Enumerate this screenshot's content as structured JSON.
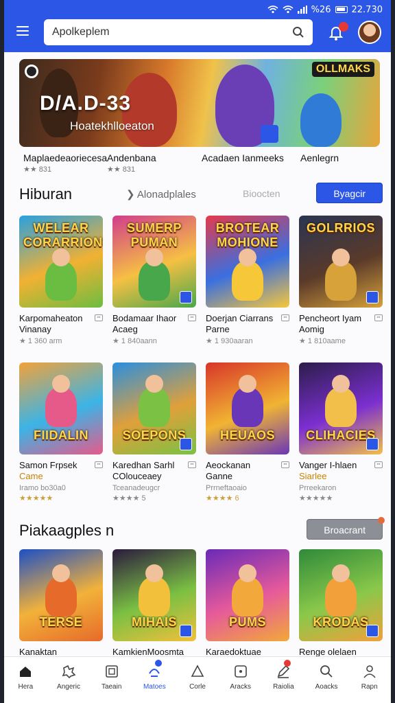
{
  "status": {
    "time": "22.730",
    "battery": "%26"
  },
  "search": {
    "query": "Apolkeplem"
  },
  "banner": {
    "title": "D/A.D-33",
    "subtitle": "Hoatekhlloeaton",
    "logo": "OLLMAKS",
    "captions": [
      {
        "title": "Maplaedeaoriecesa",
        "stars": "★★ 831"
      },
      {
        "title": "Andenbana",
        "stars": "★★ 831"
      },
      {
        "title": "Acadaen Ianmeeks",
        "stars": ""
      },
      {
        "title": "Aenlegrn",
        "stars": ""
      }
    ]
  },
  "section1": {
    "title": "Hiburan",
    "link": "Alonadplales",
    "ghost": "Bioocten",
    "button": "Byagcir"
  },
  "row1": [
    {
      "art": "WELEAR CORARRIONS",
      "name": "Karpomaheaton Vinanay",
      "sub": "",
      "meta": "★ 1 360 arm",
      "stars": "",
      "colors": [
        "#29a0e0",
        "#f2b132",
        "#6bbd41"
      ]
    },
    {
      "art": "SUMERP PUMAN",
      "name": "Bodamaar Ihaor",
      "sub": "Acaeg",
      "meta": "★ 1 840aann",
      "stars": "",
      "colors": [
        "#d13d8c",
        "#f6c043",
        "#48a74b"
      ]
    },
    {
      "art": "BROTEAR MOHIONE",
      "name": "Doerjan Ciarrans Parne",
      "sub": "",
      "meta": "★ 1 930aaran",
      "stars": "",
      "colors": [
        "#e43a4b",
        "#3a6fe0",
        "#f7c73a"
      ]
    },
    {
      "art": "GOLRRIOS",
      "name": "Pencheort Iyam",
      "sub": "Aomig",
      "meta": "★ 1 810aame",
      "stars": "",
      "colors": [
        "#2a3552",
        "#5a3a2a",
        "#d7a23a"
      ]
    }
  ],
  "row2": [
    {
      "art": "FIIDALIN",
      "name": "Samon Frpsek",
      "sub": "Came",
      "meta": "Iramo bo30a0",
      "stars": "★★★★★",
      "gold": true,
      "orange": true,
      "colors": [
        "#f2a23a",
        "#3bb4e6",
        "#e65a8a"
      ]
    },
    {
      "art": "SOEPONS",
      "name": "Karedhan Sarhl COlouceaey",
      "sub": "",
      "meta": "Tceanadeugcr",
      "stars": "★★★★ 5",
      "gold": false,
      "orange": false,
      "colors": [
        "#2a8fe0",
        "#e0a03a",
        "#7bc144"
      ]
    },
    {
      "art": "HEUAOS",
      "name": "Aeockanan Ganne",
      "sub": "",
      "meta": "Prrneftaoaio",
      "stars": "★★★★ 6",
      "gold": true,
      "orange": false,
      "colors": [
        "#d8352a",
        "#f1b433",
        "#6a36b8"
      ]
    },
    {
      "art": "CLIHACIES",
      "name": "Vanger I-hlaen",
      "sub": "Siarlee",
      "meta": "Prreekaron",
      "stars": "★★★★★",
      "gold": false,
      "orange": true,
      "colors": [
        "#2b1d4a",
        "#7b2fd0",
        "#f2c04a"
      ]
    }
  ],
  "section2": {
    "title": "Piakaagples n",
    "button": "Broacrant"
  },
  "row3": [
    {
      "art": "TERSE",
      "name": "Kanaktan Ihuikaak",
      "colors": [
        "#1d4fc6",
        "#f2b23a",
        "#e66a2a"
      ]
    },
    {
      "art": "MIHAIS",
      "name": "KamkienMoosmta",
      "colors": [
        "#2b1a3e",
        "#7ac043",
        "#f2c03a"
      ]
    },
    {
      "art": "PUMS",
      "name": "Karaedoktuae",
      "colors": [
        "#6a2ab8",
        "#e65a9a",
        "#f2a83a"
      ]
    },
    {
      "art": "KRODAS",
      "name": "Renge olelaen",
      "colors": [
        "#2f8a3a",
        "#8ac84a",
        "#f2a03a"
      ]
    }
  ],
  "nav": [
    {
      "label": "Hera",
      "icon": "home-icon",
      "active": false
    },
    {
      "label": "Angeric",
      "icon": "puzzle-icon",
      "active": false
    },
    {
      "label": "Taeain",
      "icon": "gamepad-icon",
      "active": false
    },
    {
      "label": "Matoes",
      "icon": "apps-icon",
      "active": true,
      "badge": "blue"
    },
    {
      "label": "Corle",
      "icon": "triangle-icon",
      "active": false
    },
    {
      "label": "Aracks",
      "icon": "box-icon",
      "active": false
    },
    {
      "label": "Raiolia",
      "icon": "pencil-icon",
      "active": false,
      "badge": "red"
    },
    {
      "label": "Aoacks",
      "icon": "search-icon",
      "active": false
    },
    {
      "label": "Rapn",
      "icon": "profile-icon",
      "active": false
    }
  ]
}
